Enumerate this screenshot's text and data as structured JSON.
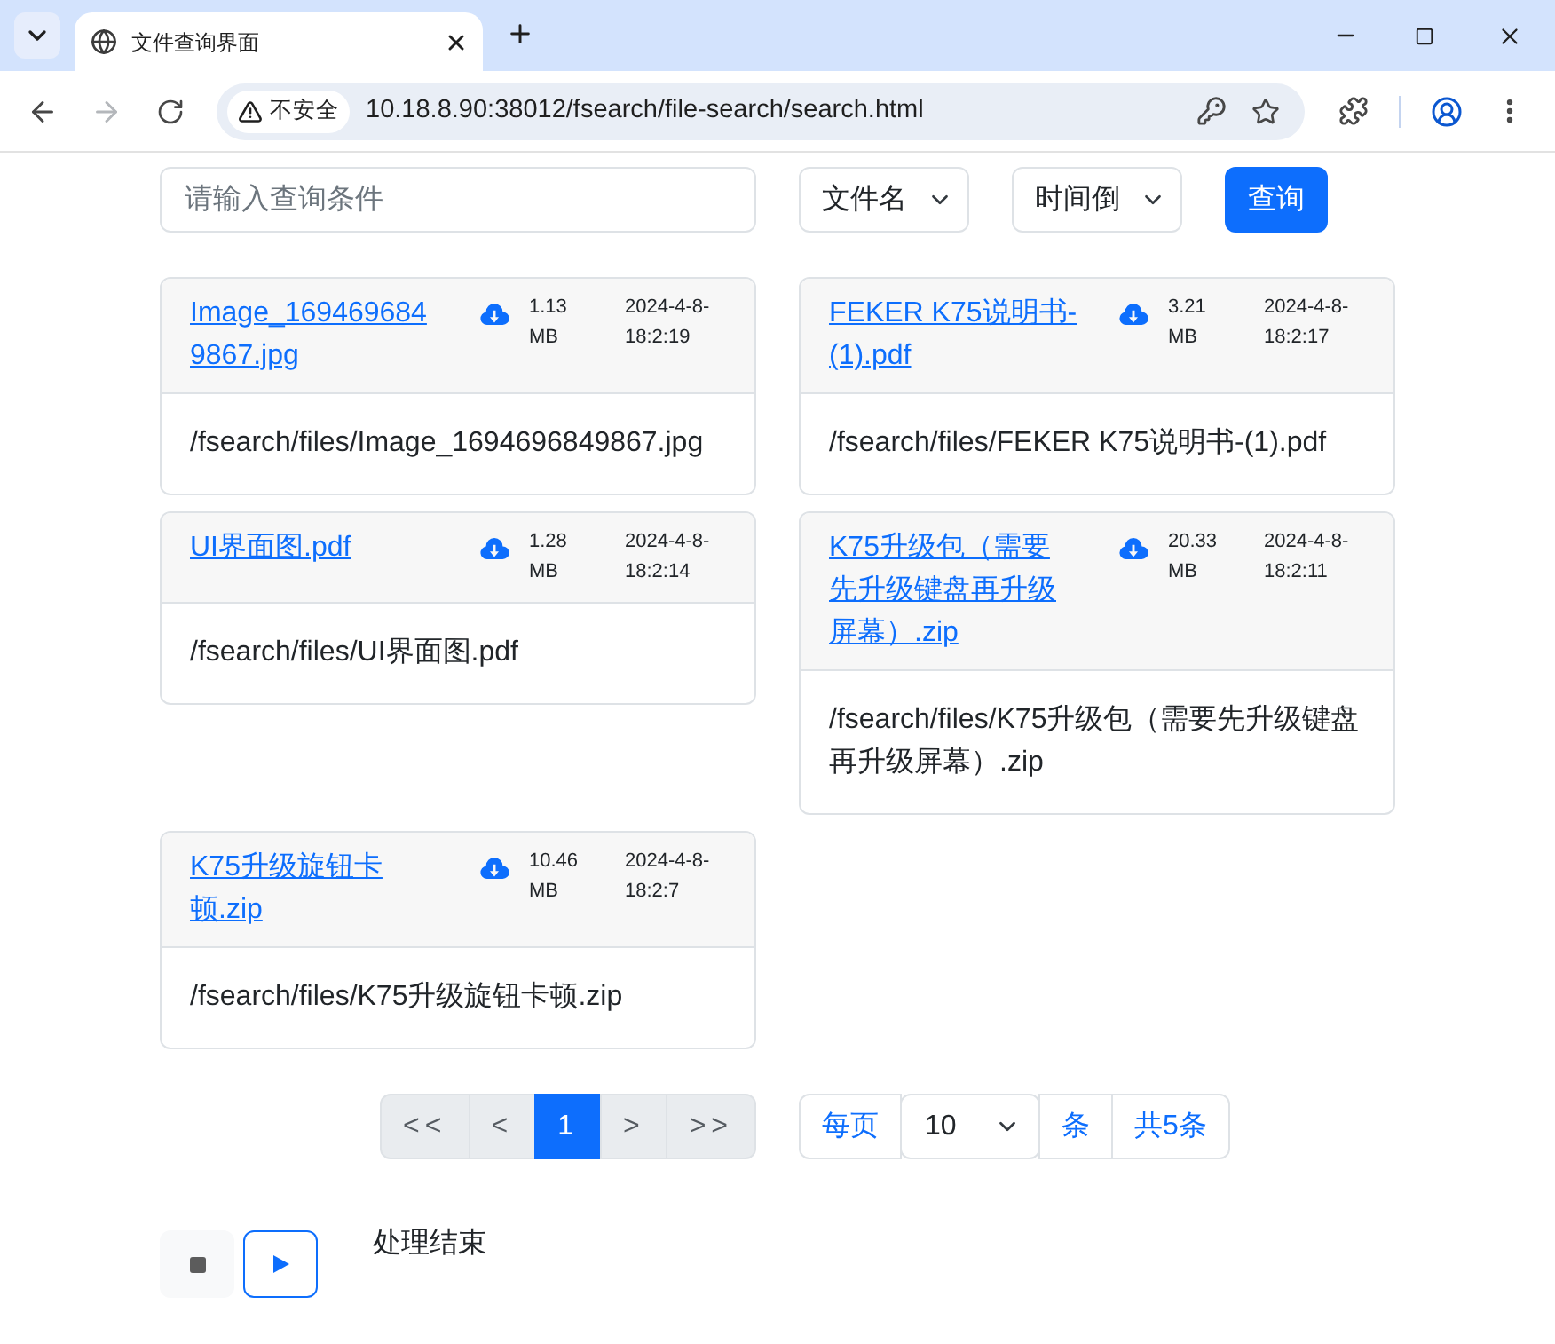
{
  "browser": {
    "tabs": [
      {
        "title": "文件查询界面",
        "selected": true
      }
    ],
    "nav_buttons": [
      {
        "kind": "back",
        "disabled": false
      },
      {
        "kind": "forward",
        "disabled": true
      },
      {
        "kind": "reload",
        "disabled": false
      }
    ],
    "address_bar": {
      "security_label": "不安全",
      "url": "10.18.8.90:38012/fsearch/file-search/search.html"
    }
  },
  "search": {
    "placeholder": "请输入查询条件",
    "filters": [
      {
        "value": "文件名"
      },
      {
        "value": "时间倒"
      }
    ],
    "button": "查询"
  },
  "files": [
    {
      "name": "Image_1694696849867.jpg",
      "size": "1.13 MB",
      "time": "2024-4-8-18:2:19",
      "path": "/fsearch/files/Image_1694696849867.jpg"
    },
    {
      "name": "FEKER K75说明书-(1).pdf",
      "size": "3.21 MB",
      "time": "2024-4-8-18:2:17",
      "path": "/fsearch/files/FEKER K75说明书-(1).pdf"
    },
    {
      "name": "UI界面图.pdf",
      "size": "1.28 MB",
      "time": "2024-4-8-18:2:14",
      "path": "/fsearch/files/UI界面图.pdf"
    },
    {
      "name": "K75升级包（需要先升级键盘再升级屏幕）.zip",
      "size": "20.33 MB",
      "time": "2024-4-8-18:2:11",
      "path": "/fsearch/files/K75升级包（需要先升级键盘再升级屏幕）.zip"
    },
    {
      "name": "K75升级旋钮卡顿.zip",
      "size": "10.46 MB",
      "time": "2024-4-8-18:2:7",
      "path": "/fsearch/files/K75升级旋钮卡顿.zip"
    }
  ],
  "pagination": {
    "pages": [
      {
        "label": "<<",
        "selected": false,
        "disabled": true
      },
      {
        "label": "<",
        "selected": false,
        "disabled": true
      },
      {
        "label": "1",
        "selected": true,
        "disabled": false
      },
      {
        "label": ">",
        "selected": false,
        "disabled": true
      },
      {
        "label": ">>",
        "selected": false,
        "disabled": true
      }
    ],
    "per_page_label": "每页",
    "page_size": "10",
    "unit": "条",
    "total": "共5条"
  },
  "player": {
    "buttons": [
      {
        "kind": "stop",
        "disabled": true
      },
      {
        "kind": "play",
        "disabled": false
      }
    ],
    "status": "处理结束"
  }
}
